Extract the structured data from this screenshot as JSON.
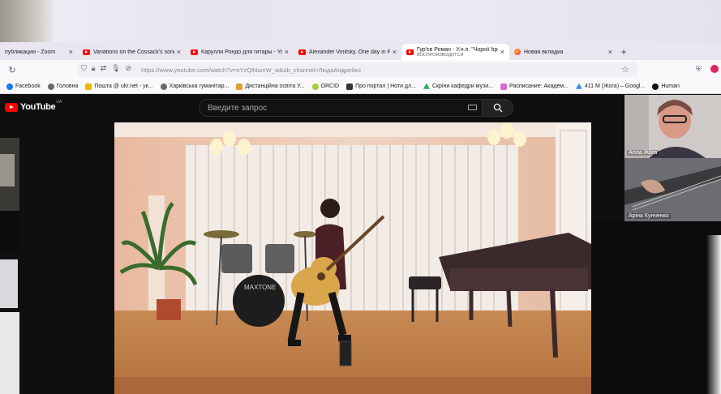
{
  "tabs": [
    {
      "label": "публикации - Zoom",
      "favicon": "zoom-icon",
      "active": false
    },
    {
      "label": "Variations on the Cossack's song",
      "favicon": "youtube-icon",
      "active": false
    },
    {
      "label": "Карулли Рондо для гитары - YouTube",
      "favicon": "youtube-icon",
      "active": false
    },
    {
      "label": "Alexander Vinitsky. One day in Paris",
      "favicon": "youtube-icon",
      "active": false
    },
    {
      "label": "Гур'єв Роман - У.н.п. \"Чорнії брови\"",
      "subtitle": "ВОСПРОИЗВОДИТСЯ",
      "favicon": "youtube-icon",
      "active": true
    },
    {
      "label": "Новая вкладка",
      "favicon": "firefox-icon",
      "active": false
    }
  ],
  "new_tab": "+",
  "urlbar": {
    "url": "https://www.youtube.com/watch?v=nYzQlNumW_w&ab_channel=ЛюдаАндрейко"
  },
  "bookmarks": [
    {
      "label": "Facebook",
      "color": "#1877f2"
    },
    {
      "label": "Головна",
      "color": "#6b6b6b"
    },
    {
      "label": "Пошта @ ukr.net - ук...",
      "color": "#f0b400"
    },
    {
      "label": "Харківська гуманітар...",
      "color": "#6b6b6b"
    },
    {
      "label": "Дистанційна освіта У...",
      "color": "#e0a030"
    },
    {
      "label": "ORCID",
      "color": "#a6ce39"
    },
    {
      "label": "Про портал | Ноти дл...",
      "color": "#333333"
    },
    {
      "label": "Скріни кафедри музи...",
      "color": "#34a853"
    },
    {
      "label": "Расписание: Академ...",
      "color": "#d66bd6"
    },
    {
      "label": "411 М (Жога) – Googl...",
      "color": "#4285f4"
    },
    {
      "label": "Human",
      "color": "#111111"
    }
  ],
  "youtube": {
    "logo": "YouTube",
    "region": "UA",
    "search_placeholder": "Введите запрос"
  },
  "participants": [
    {
      "name": "Алла Жога"
    },
    {
      "name": "Аріна Кунченко"
    }
  ],
  "video": {
    "drum_brand": "MAXTONE"
  },
  "colors": {
    "youtube_red": "#ff0000",
    "youtube_bg": "#0f0f0f"
  }
}
